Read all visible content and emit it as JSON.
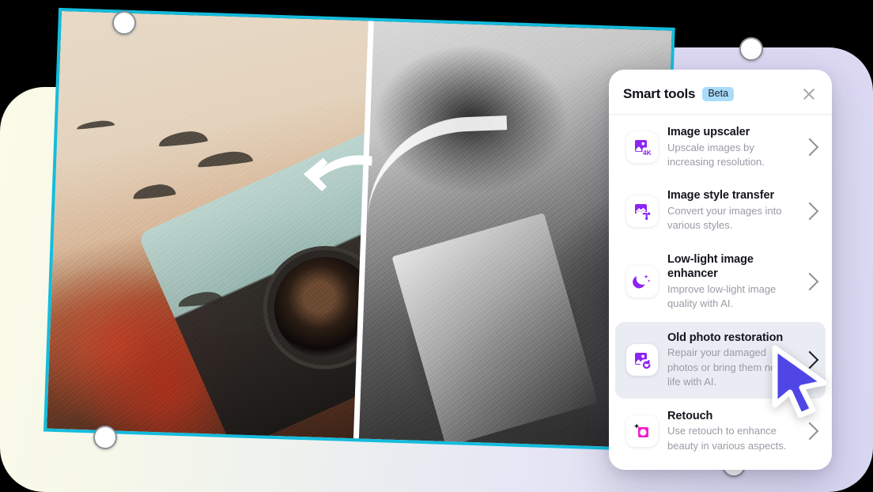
{
  "panel": {
    "title": "Smart tools",
    "badge": "Beta",
    "close_icon": "close-icon",
    "tools": [
      {
        "name": "Image upscaler",
        "desc": "Upscale images by increasing resolution.",
        "icon": "image-4k-icon",
        "icon_color": "#8B24F5",
        "active": false
      },
      {
        "name": "Image style transfer",
        "desc": "Convert your images into various styles.",
        "icon": "image-style-transfer-icon",
        "icon_color": "#8B24F5",
        "active": false
      },
      {
        "name": "Low-light image enhancer",
        "desc": "Improve low-light image quality with AI.",
        "icon": "moon-sparkle-icon",
        "icon_color": "#8B24F5",
        "active": false
      },
      {
        "name": "Old photo restoration",
        "desc": "Repair your damaged photos or bring them new life with AI.",
        "icon": "photo-restore-icon",
        "icon_color": "#8B24F5",
        "active": true
      },
      {
        "name": "Retouch",
        "desc": "Use retouch to enhance beauty in various aspects.",
        "icon": "retouch-sparkle-icon",
        "icon_color": "#F11FD2",
        "active": false
      }
    ]
  },
  "canvas": {
    "selection_color": "#14BCDC",
    "handle_fill": "#FFFFFF",
    "handle_border": "#8D9298",
    "compare_divider_color": "#FFFFFF",
    "handles": [
      "handle-top-left",
      "handle-top-right",
      "handle-bottom-left",
      "handle-bottom-right"
    ]
  },
  "background": {
    "gradient_from": "#FBFBE8",
    "gradient_to": "#D9D6F2"
  },
  "cursor": {
    "name": "mouse-pointer",
    "fill": "#4F46E5",
    "stroke": "#FFFFFF"
  }
}
